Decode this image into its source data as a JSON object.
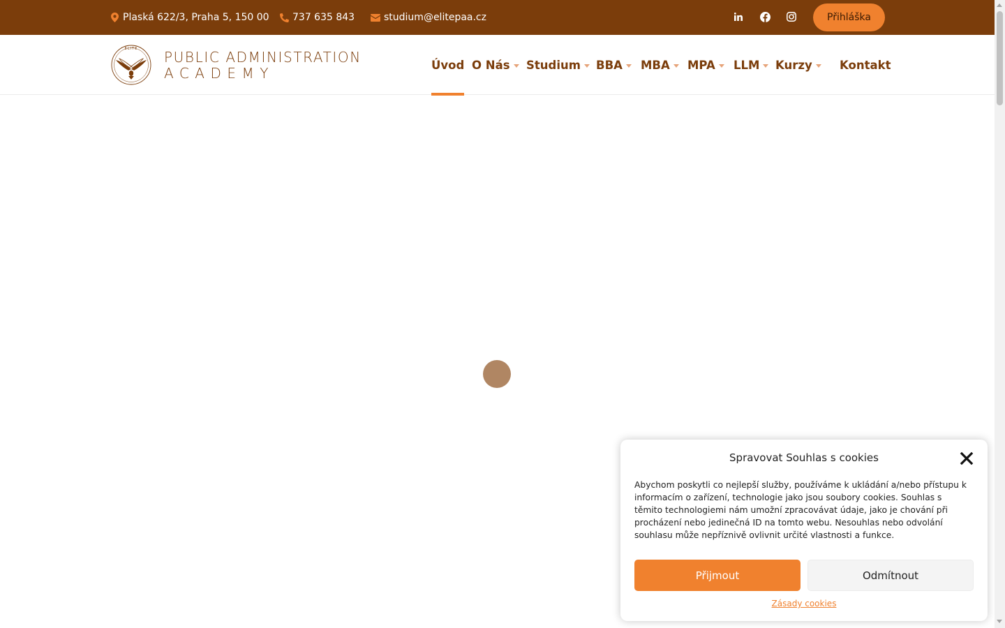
{
  "topbar": {
    "address": "Plaská 622/3, Praha 5, 150 00",
    "phone": "737 635 843",
    "email": "studium@elitepaa.cz",
    "social": [
      "linkedin-icon",
      "facebook-icon",
      "instagram-icon"
    ],
    "apply_label": "Přihláška"
  },
  "logo": {
    "line1": "PUBLIC ADMINISTRATION",
    "line2": "ACADEMY",
    "emblem_top": "ELITE",
    "emblem_ring": "PUBLIC ADMINISTRATION ACADEMY"
  },
  "nav": [
    {
      "label": "Úvod",
      "dropdown": false,
      "active": true
    },
    {
      "label": "O Nás",
      "dropdown": true
    },
    {
      "label": "Studium",
      "dropdown": true
    },
    {
      "label": "BBA",
      "dropdown": true
    },
    {
      "label": "MBA",
      "dropdown": true
    },
    {
      "label": "MPA",
      "dropdown": true
    },
    {
      "label": "LLM",
      "dropdown": true
    },
    {
      "label": "Kurzy",
      "dropdown": true
    },
    {
      "label": "Kontakt",
      "dropdown": false
    }
  ],
  "cookie": {
    "title": "Spravovat Souhlas s cookies",
    "text": "Abychom poskytli co nejlepší služby, používáme k ukládání a/nebo přístupu k informacím o zařízení, technologie jako jsou soubory cookies. Souhlas s těmito technologiemi nám umožní zpracovávat údaje, jako je chování při procházení nebo jedinečná ID na tomto webu. Nesouhlas nebo odvolání souhlasu může nepříznivě ovlivnit určité vlastnosti a funkce.",
    "accept_label": "Přijmout",
    "deny_label": "Odmítnout",
    "policy_link": "Zásady cookies"
  },
  "colors": {
    "brand_brown": "#7b3d0b",
    "accent_orange": "#f0812e",
    "loader": "#b08663"
  }
}
